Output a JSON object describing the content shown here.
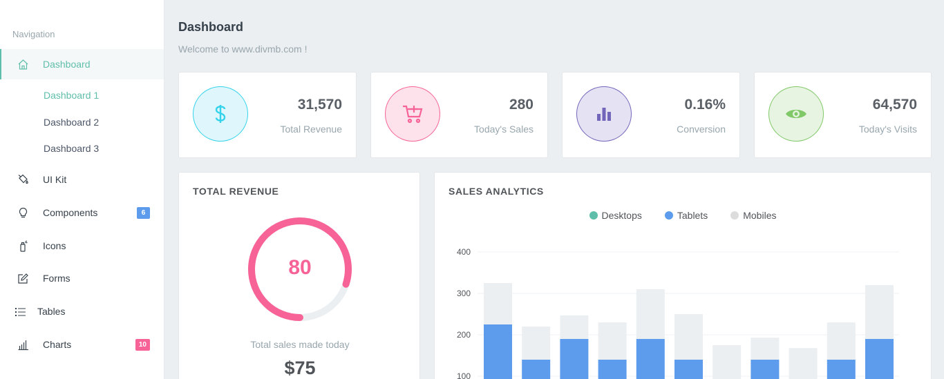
{
  "sidebar": {
    "title": "Navigation",
    "items": [
      {
        "label": "Dashboard",
        "icon": "home-icon"
      },
      {
        "label": "UI Kit",
        "icon": "paint-bucket-icon"
      },
      {
        "label": "Components",
        "icon": "lightbulb-icon",
        "badge": "6",
        "badge_color": "#5d9cec"
      },
      {
        "label": "Icons",
        "icon": "spray-can-icon"
      },
      {
        "label": "Forms",
        "icon": "edit-icon"
      },
      {
        "label": "Tables",
        "icon": "list-icon"
      },
      {
        "label": "Charts",
        "icon": "bar-chart-icon",
        "badge": "10",
        "badge_color": "#f76397"
      }
    ],
    "sub_items": [
      "Dashboard 1",
      "Dashboard 2",
      "Dashboard 3"
    ]
  },
  "header": {
    "title": "Dashboard",
    "subtitle": "Welcome to www.divmb.com !"
  },
  "stats": [
    {
      "value": "31,570",
      "label": "Total Revenue",
      "icon": "dollar-icon",
      "color": "#34d3eb",
      "bg": "#dff7fc"
    },
    {
      "value": "280",
      "label": "Today's Sales",
      "icon": "cart-plus-icon",
      "color": "#f76397",
      "bg": "#fde2ec"
    },
    {
      "value": "0.16%",
      "label": "Conversion",
      "icon": "bar-chart-icon",
      "color": "#7266ba",
      "bg": "#e5e3f3"
    },
    {
      "value": "64,570",
      "label": "Today's Visits",
      "icon": "eye-icon",
      "color": "#81c868",
      "bg": "#e6f4e1"
    }
  ],
  "revenue": {
    "title": "TOTAL REVENUE",
    "gauge_value": "80",
    "gauge_fraction": 0.8,
    "gauge_color": "#f76397",
    "caption": "Total sales made today",
    "amount": "$75"
  },
  "analytics": {
    "title": "SALES ANALYTICS"
  },
  "chart_data": {
    "type": "bar",
    "stacked": true,
    "series": [
      {
        "name": "Desktops",
        "color": "#5fbeaa",
        "values": [
          0,
          0,
          5,
          0,
          5,
          0,
          0,
          0,
          0,
          0,
          5
        ]
      },
      {
        "name": "Tablets",
        "color": "#5d9cec",
        "values": [
          225,
          140,
          185,
          140,
          185,
          140,
          0,
          140,
          0,
          140,
          185
        ]
      },
      {
        "name": "Mobiles",
        "color": "#ebeff2",
        "values": [
          100,
          80,
          57,
          90,
          120,
          110,
          175,
          53,
          168,
          90,
          130
        ]
      }
    ],
    "yticks": [
      100,
      200,
      300,
      400
    ],
    "ylim": [
      70,
      400
    ],
    "grid": true,
    "legend": "top-center"
  }
}
